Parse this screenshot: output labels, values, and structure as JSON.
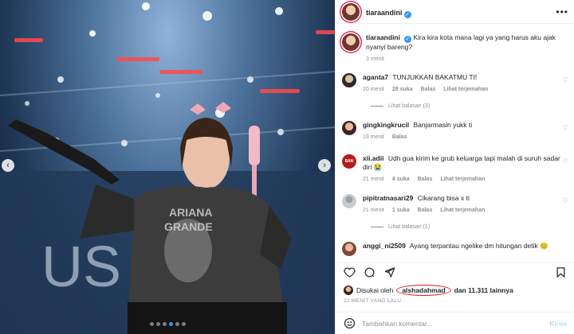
{
  "post": {
    "author": "tiaraandini",
    "caption": {
      "user": "tiaraandini",
      "text": "Kira kira kota mana lagi ya yang harus aku ajak nyanyi bareng?",
      "time": "3 menit"
    },
    "carousel": {
      "slide_count": 6,
      "active_index": 3
    }
  },
  "comments": [
    {
      "user": "aganta7",
      "text": "TUNJUKKAN BAKATMU TI!",
      "time": "20 menit",
      "likes": "28 suka",
      "reply": "Balas",
      "translate": "Lihat terjemahan",
      "view_replies": "Lihat balasan (3)",
      "avatar_label": ""
    },
    {
      "user": "gingkingkrucil",
      "text": "Banjarmasin yukk ti",
      "time": "19 menit",
      "likes": "",
      "reply": "Balas",
      "translate": "",
      "view_replies": "",
      "avatar_label": ""
    },
    {
      "user": "xii.adii",
      "text": "Udh gua kirim ke grub keluarga tapi malah di suruh sadar diri 😭",
      "time": "21 menit",
      "likes": "4 suka",
      "reply": "Balas",
      "translate": "Lihat terjemahan",
      "view_replies": "",
      "avatar_label": "BAN"
    },
    {
      "user": "pipitratnasari29",
      "text": "Cikarang bisa x ti",
      "time": "21 menit",
      "likes": "1 suka",
      "reply": "Balas",
      "translate": "Lihat terjemahan",
      "view_replies": "Lihat balasan (1)",
      "avatar_label": ""
    },
    {
      "user": "anggi_ni2509",
      "text": "Ayang terpantau ngelike dm hitungan detik 😊",
      "time": "",
      "likes": "",
      "reply": "",
      "translate": "",
      "view_replies": "",
      "avatar_label": ""
    }
  ],
  "likes": {
    "prefix": "Disukai oleh",
    "user": "alshadahmad",
    "suffix": "dan 11.311 lainnya"
  },
  "posted_time": "22 MENIT YANG LALU",
  "composer": {
    "placeholder": "Tambahkan komentar...",
    "post_label": "Kirim"
  },
  "icons": {
    "like": "heart-icon",
    "comment": "comment-icon",
    "share": "send-icon",
    "save": "bookmark-icon",
    "emoji": "emoji-icon",
    "more": "more-icon",
    "verified": "verified-badge-icon"
  },
  "colors": {
    "accent": "#3897f0",
    "highlight": "#e0191d",
    "muted": "#8e8e8e"
  }
}
